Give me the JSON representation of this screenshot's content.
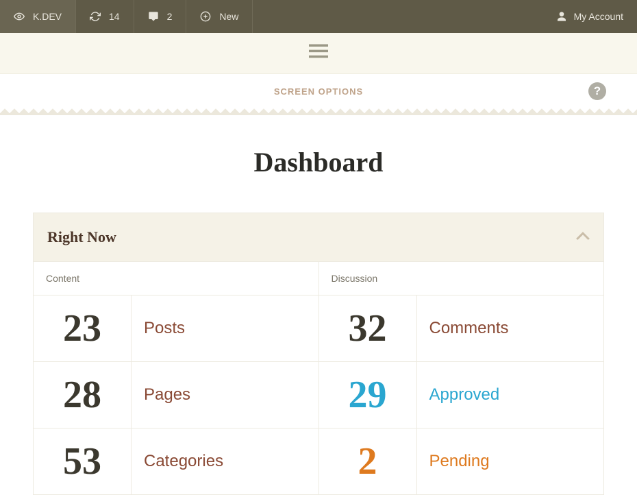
{
  "topbar": {
    "site": "K.DEV",
    "updates": "14",
    "comments": "2",
    "new": "New",
    "account": "My Account"
  },
  "controls": {
    "screen_options": "SCREEN OPTIONS"
  },
  "page": {
    "title": "Dashboard"
  },
  "widget": {
    "title": "Right Now",
    "columns": {
      "content": "Content",
      "discussion": "Discussion"
    },
    "rows": [
      {
        "cnum": "23",
        "clab": "Posts",
        "clab_cls": "c-brown",
        "dnum": "32",
        "dlab": "Comments",
        "dlab_cls": "c-brown",
        "dnum_cls": ""
      },
      {
        "cnum": "28",
        "clab": "Pages",
        "clab_cls": "c-brown",
        "dnum": "29",
        "dlab": "Approved",
        "dlab_cls": "c-blue",
        "dnum_cls": "n-blue"
      },
      {
        "cnum": "53",
        "clab": "Categories",
        "clab_cls": "c-brown",
        "dnum": "2",
        "dlab": "Pending",
        "dlab_cls": "c-orange",
        "dnum_cls": "n-orange"
      }
    ]
  }
}
